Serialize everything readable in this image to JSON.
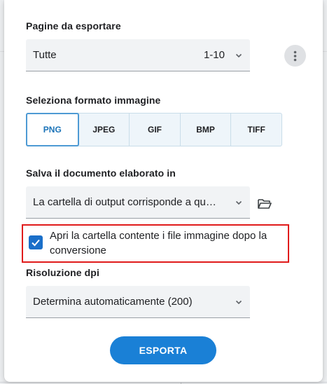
{
  "pages": {
    "label": "Pagine da esportare",
    "selected": "Tutte",
    "range": "1-10"
  },
  "more_icon": "more-vertical-icon",
  "format": {
    "label": "Seleziona formato immagine",
    "options": [
      "PNG",
      "JPEG",
      "GIF",
      "BMP",
      "TIFF"
    ],
    "selected": "PNG"
  },
  "save": {
    "label": "Salva il documento elaborato in",
    "selected": "La cartella di output corrisponde a qu…",
    "folder_icon": "folder-open-icon"
  },
  "open_folder": {
    "label": "Apri la cartella contente i file immagine dopo la conversione",
    "checked": true
  },
  "resolution": {
    "label": "Risoluzione dpi",
    "selected": "Determina automaticamente (200)"
  },
  "export_button": "ESPORTA",
  "colors": {
    "accent": "#1a80d6",
    "checkbox": "#1a6fc9",
    "highlight_border": "#e01b1b"
  }
}
